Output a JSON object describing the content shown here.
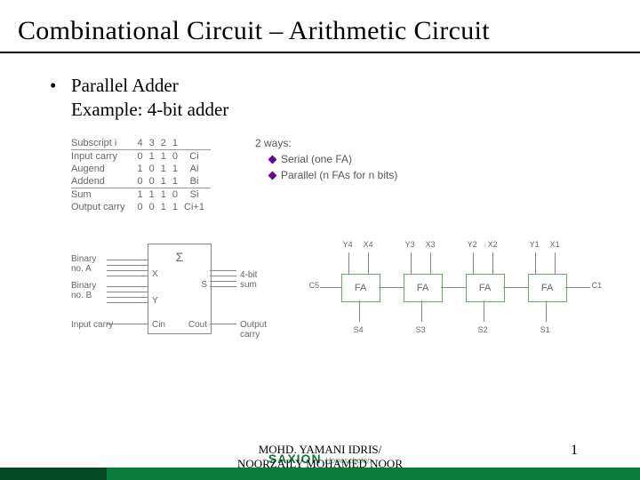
{
  "title": "Combinational Circuit – Arithmetic Circuit",
  "bullet": "Parallel Adder",
  "example": "Example: 4-bit adder",
  "table": {
    "header": [
      "Subscript i",
      "4",
      "3",
      "2",
      "1",
      ""
    ],
    "rows": [
      [
        "Input carry",
        "0",
        "1",
        "1",
        "0",
        "Ci"
      ],
      [
        "Augend",
        "1",
        "0",
        "1",
        "1",
        "Ai"
      ],
      [
        "Addend",
        "0",
        "0",
        "1",
        "1",
        "Bi"
      ],
      [
        "Sum",
        "1",
        "1",
        "1",
        "0",
        "Si"
      ],
      [
        "Output carry",
        "0",
        "0",
        "1",
        "1",
        "Ci+1"
      ]
    ]
  },
  "ways": {
    "title": "2 ways:",
    "items": [
      "Serial (one FA)",
      "Parallel (n FAs for n bits)"
    ]
  },
  "block": {
    "sigma": "Σ",
    "binA": "Binary\nno. A",
    "X": "X",
    "S": "S",
    "sum4": "4-bit\nsum",
    "binB": "Binary\nno. B",
    "Y": "Y",
    "incarry": "Input carry",
    "Cin": "Cin",
    "Cout": "Cout",
    "outcarry": "Output carry"
  },
  "fa": {
    "box": "FA",
    "top": [
      "Y4",
      "X4",
      "Y3",
      "X3",
      "Y2",
      "X2",
      "Y1",
      "X1"
    ],
    "left": "C5",
    "right": "C1",
    "bottom": [
      "S4",
      "S3",
      "S2",
      "S1"
    ]
  },
  "logo": {
    "main": "SAXION",
    "sub": "Hogescholen"
  },
  "authors": {
    "l1": "MOHD. YAMANI IDRIS/",
    "l2": "NOORZAILY MOHAMED NOOR"
  },
  "page": "1"
}
